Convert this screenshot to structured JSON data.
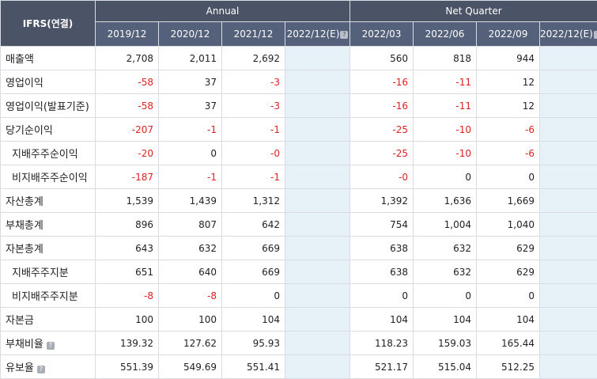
{
  "table": {
    "corner_label": "IFRS(연결)",
    "group_annual": "Annual",
    "group_quarter": "Net Quarter",
    "periods": [
      "2019/12",
      "2020/12",
      "2021/12",
      "2022/12(E)",
      "2022/03",
      "2022/06",
      "2022/09",
      "2022/12(E)"
    ],
    "estimate_columns": [
      3,
      7
    ],
    "colors": {
      "header_bg": "#4a5466",
      "negative": "#e02020",
      "estimate_bg": "#e6f2f8"
    },
    "rows": [
      {
        "label": "매출액",
        "indent": false,
        "help": false,
        "values": [
          "2,708",
          "2,011",
          "2,692",
          "",
          "560",
          "818",
          "944",
          ""
        ]
      },
      {
        "label": "영업이익",
        "indent": false,
        "help": false,
        "values": [
          "-58",
          "37",
          "-3",
          "",
          "-16",
          "-11",
          "12",
          ""
        ]
      },
      {
        "label": "영업이익(발표기준)",
        "indent": false,
        "help": false,
        "values": [
          "-58",
          "37",
          "-3",
          "",
          "-16",
          "-11",
          "12",
          ""
        ]
      },
      {
        "label": "당기순이익",
        "indent": false,
        "help": false,
        "values": [
          "-207",
          "-1",
          "-1",
          "",
          "-25",
          "-10",
          "-6",
          ""
        ]
      },
      {
        "label": "지배주주순이익",
        "indent": true,
        "help": false,
        "values": [
          "-20",
          "0",
          "-0",
          "",
          "-25",
          "-10",
          "-6",
          ""
        ]
      },
      {
        "label": "비지배주주순이익",
        "indent": true,
        "help": false,
        "values": [
          "-187",
          "-1",
          "-1",
          "",
          "-0",
          "0",
          "0",
          ""
        ]
      },
      {
        "label": "자산총계",
        "indent": false,
        "help": false,
        "values": [
          "1,539",
          "1,439",
          "1,312",
          "",
          "1,392",
          "1,636",
          "1,669",
          ""
        ]
      },
      {
        "label": "부채총계",
        "indent": false,
        "help": false,
        "values": [
          "896",
          "807",
          "642",
          "",
          "754",
          "1,004",
          "1,040",
          ""
        ]
      },
      {
        "label": "자본총계",
        "indent": false,
        "help": false,
        "values": [
          "643",
          "632",
          "669",
          "",
          "638",
          "632",
          "629",
          ""
        ]
      },
      {
        "label": "지배주주지분",
        "indent": true,
        "help": false,
        "values": [
          "651",
          "640",
          "669",
          "",
          "638",
          "632",
          "629",
          ""
        ]
      },
      {
        "label": "비지배주주지분",
        "indent": true,
        "help": false,
        "values": [
          "-8",
          "-8",
          "0",
          "",
          "0",
          "0",
          "0",
          ""
        ]
      },
      {
        "label": "자본금",
        "indent": false,
        "help": false,
        "values": [
          "100",
          "100",
          "104",
          "",
          "104",
          "104",
          "104",
          ""
        ]
      },
      {
        "label": "부채비율",
        "indent": false,
        "help": true,
        "values": [
          "139.32",
          "127.62",
          "95.93",
          "",
          "118.23",
          "159.03",
          "165.44",
          ""
        ]
      },
      {
        "label": "유보율",
        "indent": false,
        "help": true,
        "values": [
          "551.39",
          "549.69",
          "551.41",
          "",
          "521.17",
          "515.04",
          "512.25",
          ""
        ]
      }
    ]
  }
}
